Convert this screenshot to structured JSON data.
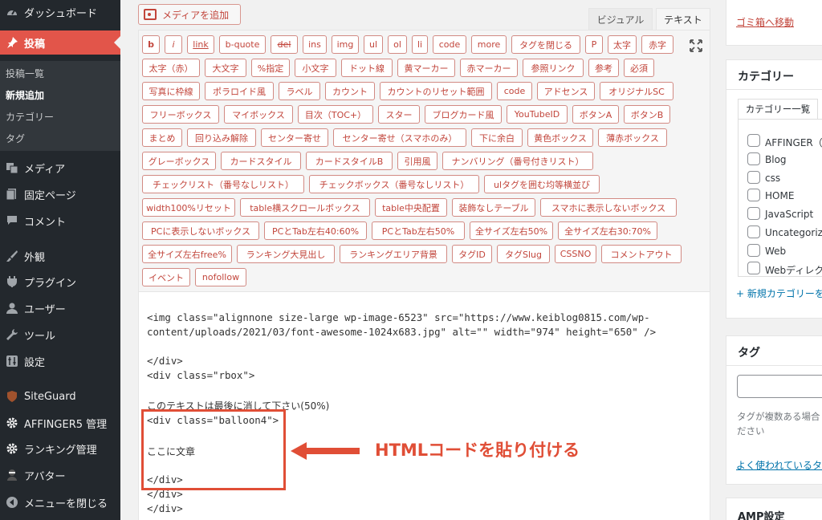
{
  "sidebar": {
    "items": [
      {
        "label": "ダッシュボード",
        "icon": "dashboard-icon"
      },
      {
        "label": "投稿",
        "icon": "pushpin-icon",
        "active": true
      },
      {
        "label": "メディア",
        "icon": "media-icon"
      },
      {
        "label": "固定ページ",
        "icon": "page-icon"
      },
      {
        "label": "コメント",
        "icon": "comment-icon"
      },
      {
        "label": "外観",
        "icon": "brush-icon"
      },
      {
        "label": "プラグイン",
        "icon": "plugin-icon"
      },
      {
        "label": "ユーザー",
        "icon": "user-icon"
      },
      {
        "label": "ツール",
        "icon": "wrench-icon"
      },
      {
        "label": "設定",
        "icon": "settings-icon"
      },
      {
        "label": "SiteGuard",
        "icon": "shield-icon"
      },
      {
        "label": "AFFINGER5 管理",
        "icon": "gear-icon"
      },
      {
        "label": "ランキング管理",
        "icon": "gear-icon"
      },
      {
        "label": "アバター",
        "icon": "avatar-icon"
      },
      {
        "label": "メニューを閉じる",
        "icon": "collapse-icon"
      }
    ],
    "submenu": [
      {
        "label": "投稿一覧"
      },
      {
        "label": "新規追加",
        "current": true
      },
      {
        "label": "カテゴリー"
      },
      {
        "label": "タグ"
      }
    ]
  },
  "editor": {
    "media_button": "メディアを追加",
    "tabs": {
      "visual": "ビジュアル",
      "text": "テキスト"
    },
    "quicktags": [
      [
        "b",
        "i",
        "link",
        "b-quote",
        "del",
        "ins",
        "img",
        "ul",
        "ol",
        "li",
        "code",
        "more",
        "タグを閉じる",
        "P",
        "太字",
        "赤字"
      ],
      [
        "太字（赤）",
        "大文字",
        "%指定",
        "小文字",
        "ドット線",
        "黄マーカー",
        "赤マーカー",
        "参照リンク",
        "参考",
        "必須"
      ],
      [
        "写真に枠線",
        "ポラロイド風",
        "ラベル",
        "カウント",
        "カウントのリセット範囲",
        "code",
        "アドセンス",
        "オリジナルSC"
      ],
      [
        "フリーボックス",
        "マイボックス",
        "目次（TOC+）",
        "スター",
        "ブログカード風",
        "YouTubeID",
        "ボタンA",
        "ボタンB"
      ],
      [
        "まとめ",
        "回り込み解除",
        "センター寄せ",
        "センター寄せ（スマホのみ）",
        "下に余白",
        "黄色ボックス",
        "薄赤ボックス"
      ],
      [
        "グレーボックス",
        "カードスタイル",
        "カードスタイルB",
        "引用風",
        "ナンバリング（番号付きリスト）"
      ],
      [
        "チェックリスト（番号なしリスト）",
        "チェックボックス（番号なしリスト）",
        "ulタグを囲む均等横並び"
      ],
      [
        "width100%リセット",
        "table横スクロールボックス",
        "table中央配置",
        "装飾なしテーブル",
        "スマホに表示しないボックス"
      ],
      [
        "PCに表示しないボックス",
        "PCとTab左右40:60%",
        "PCとTab左右50%",
        "全サイズ左右50%",
        "全サイズ左右30:70%"
      ],
      [
        "全サイズ左右free%",
        "ランキング大見出し",
        "ランキングエリア背景",
        "タグID",
        "タグSlug",
        "CSSNO",
        "コメントアウト"
      ],
      [
        "イベント",
        "nofollow"
      ]
    ],
    "code_lines": [
      "<img class=\"alignnone size-large wp-image-6523\" src=\"https://www.keiblog0815.com/wp-",
      "content/uploads/2021/03/font-awesome-1024x683.jpg\" alt=\"\" width=\"974\" height=\"650\" />",
      "</div>",
      "<div class=\"rbox\">",
      "このテキストは最後に消して下さい(50%)",
      "<div class=\"balloon4\">",
      "ここに文章",
      "</div>",
      "</div>",
      "</div>"
    ],
    "annotation": "HTMLコードを貼り付ける"
  },
  "right": {
    "trash_link": "ゴミ箱へ移動",
    "category": {
      "title": "カテゴリー",
      "tab": "カテゴリー一覧",
      "items": [
        "AFFINGER（",
        "Blog",
        "css",
        "HOME",
        "JavaScript",
        "Uncategoriz",
        "Web",
        "Webディレク"
      ],
      "add_link": "+ 新規カテゴリーを"
    },
    "tags": {
      "title": "タグ",
      "help_line1": "タグが複数ある場合",
      "help_line2": "ださい",
      "popular_link": "よく使われているタ"
    },
    "amp": {
      "title": "AMP設定"
    }
  },
  "colors": {
    "accent": "#e2554a",
    "annotation": "#e04e36",
    "sidebar_bg": "#23282d"
  }
}
